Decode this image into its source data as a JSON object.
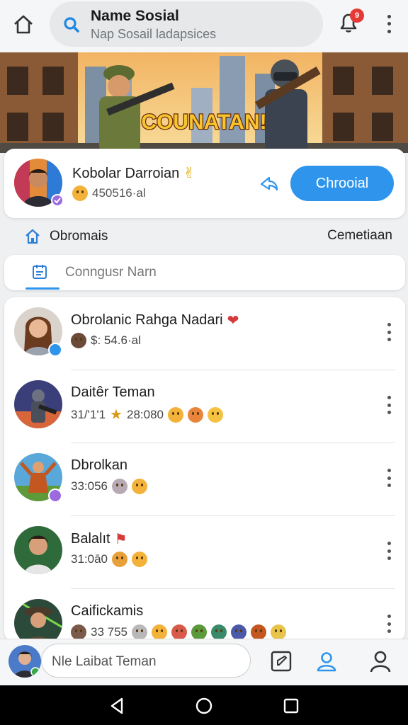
{
  "header": {
    "search_title": "Name Sosial",
    "search_subtitle": "Nap Sosail ladapsices",
    "notification_count": "9"
  },
  "banner": {
    "title": "COUNATAN!"
  },
  "profile": {
    "name": "Kobolar Darroian",
    "stat": "450516·al",
    "action_button": "Chrooial"
  },
  "section": {
    "left_label": "Obromais",
    "right_label": "Cemetiaan"
  },
  "input": {
    "placeholder": "Conngusr Narn"
  },
  "friends": [
    {
      "name": "Obrolanic Rahga Nadari",
      "meta": "$: 54.6·al",
      "badge_color": "#2f95ec"
    },
    {
      "name": "Daitêr Teman",
      "meta": "31/'1'1",
      "meta2": "28:080",
      "badge_color": ""
    },
    {
      "name": "Dbrolkan",
      "meta": "33:056",
      "badge_color": "#9c6ade"
    },
    {
      "name": "Balalıt",
      "meta": "31:0ā0",
      "badge_color": ""
    },
    {
      "name": "Caifickamis",
      "meta": "33 755",
      "badge_color": ""
    }
  ],
  "bottom_bar": {
    "compose_placeholder": "Nle Laibat Teman"
  },
  "colors": {
    "accent": "#2f95ec",
    "badge_red": "#e53935",
    "verified_purple": "#9c6ade"
  }
}
